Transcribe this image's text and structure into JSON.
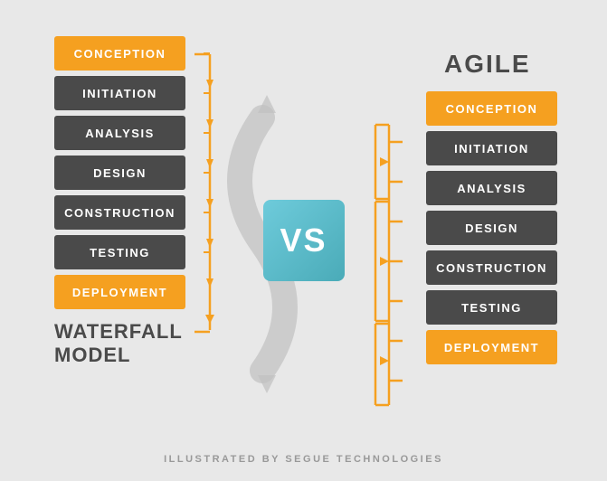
{
  "waterfall": {
    "title_line1": "WATERFALL",
    "title_line2": "MODEL",
    "steps": [
      {
        "label": "CONCEPTION",
        "type": "orange"
      },
      {
        "label": "INITIATION",
        "type": "dark"
      },
      {
        "label": "ANALYSIS",
        "type": "dark"
      },
      {
        "label": "DESIGN",
        "type": "dark"
      },
      {
        "label": "CONSTRUCTION",
        "type": "dark"
      },
      {
        "label": "TESTING",
        "type": "dark"
      },
      {
        "label": "DEPLOYMENT",
        "type": "orange"
      }
    ]
  },
  "vs": {
    "label": "VS"
  },
  "agile": {
    "title": "AGILE",
    "steps": [
      {
        "label": "CONCEPTION",
        "type": "orange"
      },
      {
        "label": "INITIATION",
        "type": "dark"
      },
      {
        "label": "ANALYSIS",
        "type": "dark"
      },
      {
        "label": "DESIGN",
        "type": "dark"
      },
      {
        "label": "CONSTRUCTION",
        "type": "dark"
      },
      {
        "label": "TESTING",
        "type": "dark"
      },
      {
        "label": "DEPLOYMENT",
        "type": "orange"
      }
    ]
  },
  "footer": {
    "text": "ILLUSTRATED BY SEGUE TECHNOLOGIES"
  },
  "colors": {
    "orange": "#f5a020",
    "dark": "#4a4a4a",
    "teal": "#5bbece",
    "bg": "#e8e8e8",
    "arrow": "#c8c8c8"
  }
}
